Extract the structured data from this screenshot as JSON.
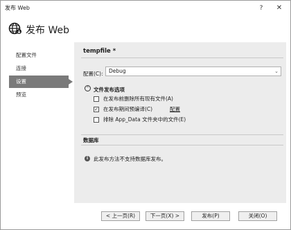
{
  "window": {
    "title": "发布 Web",
    "help_label": "?",
    "close_label": "✕"
  },
  "header": {
    "title": "发布 Web"
  },
  "nav": {
    "items": [
      {
        "label": "配置文件"
      },
      {
        "label": "连接"
      },
      {
        "label": "设置"
      },
      {
        "label": "预览"
      }
    ]
  },
  "main": {
    "profile_title": "tempfile *",
    "config_label": "配置(C):",
    "config_value": "Debug",
    "file_options_title": "文件发布选项",
    "toggle_symbol": "⌃",
    "options": [
      {
        "label": "在发布前删除所有现有文件(A)",
        "checked": false,
        "check_mark": ""
      },
      {
        "label": "在发布期间预编译(C)",
        "checked": true,
        "check_mark": "✓",
        "link": "配置"
      },
      {
        "label": "排除 App_Data 文件夹中的文件(E)",
        "checked": false,
        "check_mark": ""
      }
    ],
    "database_title": "数据库",
    "database_message": "此发布方法不支持数据库发布。",
    "info_symbol": "i"
  },
  "footer": {
    "prev": "< 上一页(R)",
    "next": "下一页(X) >",
    "publish": "发布(P)",
    "close": "关闭(O)"
  }
}
